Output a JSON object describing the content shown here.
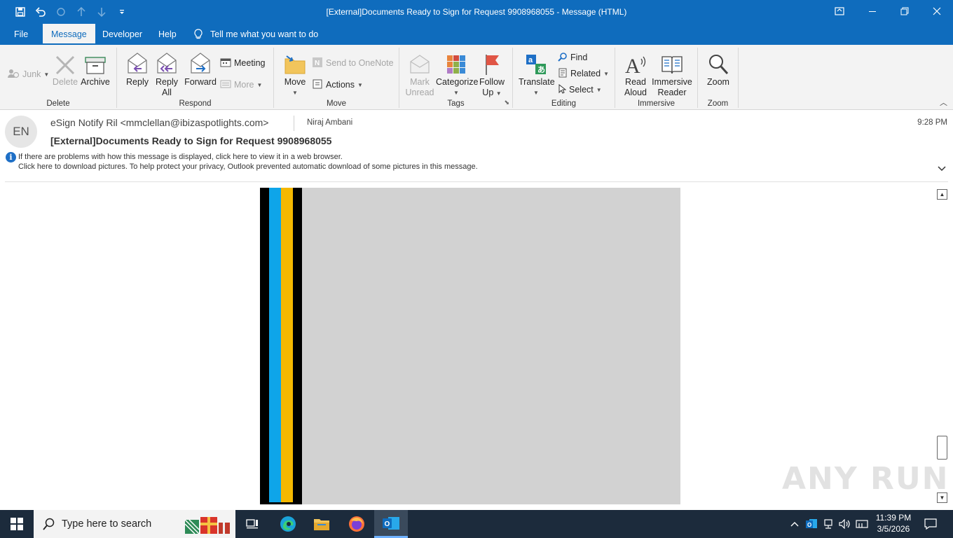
{
  "window": {
    "title": "[External]Documents Ready to Sign for Request 9908968055  -  Message (HTML)"
  },
  "tabs": [
    {
      "label": "File"
    },
    {
      "label": "Message"
    },
    {
      "label": "Developer"
    },
    {
      "label": "Help"
    }
  ],
  "tell_me": "Tell me what you want to do",
  "ribbon": {
    "delete_group": {
      "label": "Delete",
      "junk": "Junk",
      "delete": "Delete",
      "archive": "Archive"
    },
    "respond_group": {
      "label": "Respond",
      "reply": "Reply",
      "reply_all_1": "Reply",
      "reply_all_2": "All",
      "forward": "Forward",
      "meeting": "Meeting",
      "more": "More"
    },
    "move_group": {
      "label": "Move",
      "move": "Move",
      "send_to_onenote": "Send to OneNote",
      "actions": "Actions"
    },
    "tags_group": {
      "label": "Tags",
      "mark_unread_1": "Mark",
      "mark_unread_2": "Unread",
      "categorize": "Categorize",
      "follow_up_1": "Follow",
      "follow_up_2": "Up"
    },
    "editing_group": {
      "label": "Editing",
      "translate": "Translate",
      "find": "Find",
      "related": "Related",
      "select": "Select"
    },
    "immersive_group": {
      "label": "Immersive",
      "read_aloud_1": "Read",
      "read_aloud_2": "Aloud",
      "immersive_reader_1": "Immersive",
      "immersive_reader_2": "Reader"
    },
    "zoom_group": {
      "label": "Zoom",
      "zoom": "Zoom"
    }
  },
  "message": {
    "avatar_initials": "EN",
    "from": "eSign Notify Ril <mmclellan@ibizaspotlights.com>",
    "to": "Niraj Ambani",
    "time": "9:28 PM",
    "subject": "[External]Documents Ready to Sign for Request 9908968055",
    "info_line_1": "If there are problems with how this message is displayed, click here to view it in a web browser.",
    "info_line_2": "Click here to download pictures. To help protect your privacy, Outlook prevented automatic download of some pictures in this message."
  },
  "watermark": "ANY RUN",
  "taskbar": {
    "search_placeholder": "Type here to search",
    "time": "11:39 PM",
    "date": "3/5/2026"
  },
  "colors": {
    "accent": "#0f6cbd",
    "image_bar_blue": "#0ea5e9",
    "image_bar_gold": "#f5b800",
    "image_placeholder": "#d2d2d2"
  }
}
